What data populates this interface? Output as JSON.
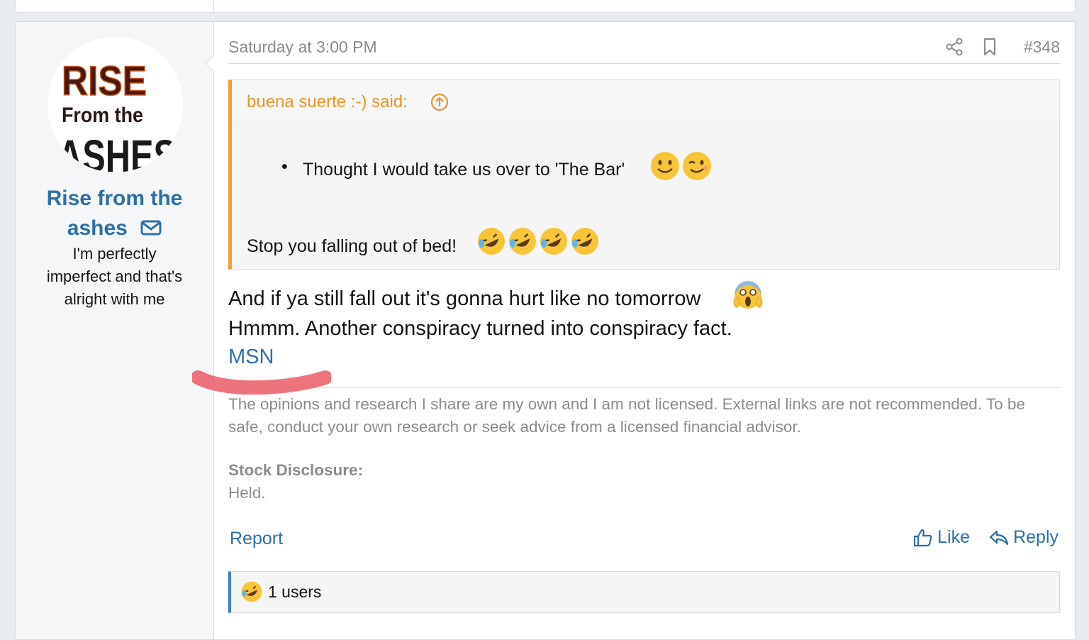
{
  "user": {
    "name": "Rise from the ashes",
    "avatar_text_1": "RISE",
    "avatar_text_2": "From the",
    "avatar_text_3": "ASHES",
    "title_lines": [
      "I'm perfectly",
      "imperfect and that's",
      "alright with me"
    ]
  },
  "post": {
    "date": "Saturday at 3:00 PM",
    "number": "#348",
    "quote": {
      "author": "buena suerte :-) said:",
      "bullet": "Thought I would take us over to 'The Bar'",
      "line": "Stop you falling out of bed!"
    },
    "body": [
      "And if ya still fall out it's gonna hurt like no tomorrow",
      "Hmmm. Another conspiracy turned into conspiracy fact."
    ],
    "link": "MSN",
    "signature": "The opinions and research I share are my own and I am not licensed. External links are not recommended. To be safe, conduct your own research or seek advice from a licensed financial advisor.",
    "disclosure_label": "Stock Disclosure:",
    "disclosure_value": "Held."
  },
  "actions": {
    "report": "Report",
    "like": "Like",
    "reply": "Reply"
  },
  "reactions": {
    "count_text": "1 users"
  },
  "colors": {
    "link": "#2f6fa6",
    "quote_accent": "#f0a035",
    "reaction_accent": "#3d7ec6"
  }
}
